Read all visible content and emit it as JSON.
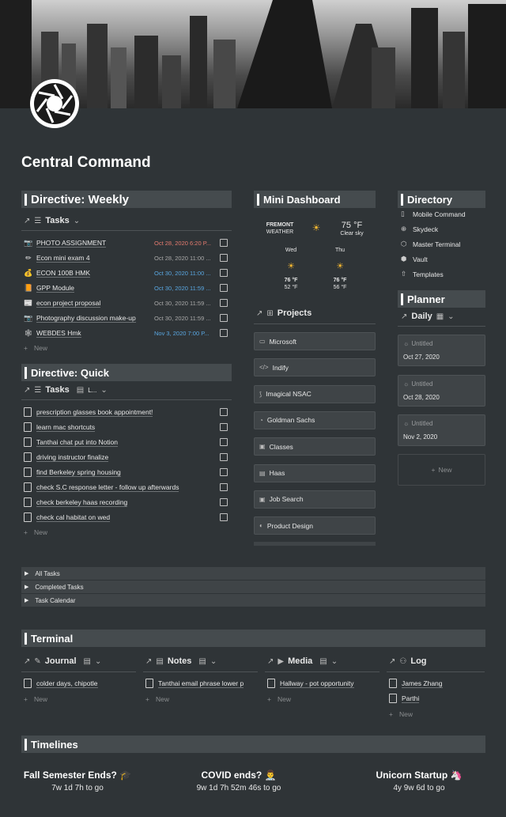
{
  "page": {
    "title": "Central Command"
  },
  "weekly": {
    "header": "Directive: Weekly",
    "view_label": "Tasks",
    "new_label": "New",
    "tasks": [
      {
        "icon": "📷",
        "name": "PHOTO ASSIGNMENT",
        "date": "Oct 28, 2020 6:20 P...",
        "status": "red"
      },
      {
        "icon": "✏",
        "name": "Econ mini exam 4",
        "date": "Oct 28, 2020 11:00 ...",
        "status": "gray"
      },
      {
        "icon": "💰",
        "name": "ECON 100B HMK",
        "date": "Oct 30, 2020 11:00 ...",
        "status": "blue"
      },
      {
        "icon": "📙",
        "name": "GPP Module",
        "date": "Oct 30, 2020 11:59 ...",
        "status": "blue"
      },
      {
        "icon": "📰",
        "name": "econ project proposal",
        "date": "Oct 30, 2020 11:59 ...",
        "status": "gray"
      },
      {
        "icon": "📷",
        "name": "Photography discussion make-up",
        "date": "Oct 30, 2020 11:59 ...",
        "status": "gray"
      },
      {
        "icon": "🕸",
        "name": "WEBDES Hmk",
        "date": "Nov 3, 2020 7:00 P...",
        "status": "blue"
      }
    ]
  },
  "quick": {
    "header": "Directive: Quick",
    "view_label": "Tasks",
    "view2_label": "L...",
    "new_label": "New",
    "tasks": [
      "prescription glasses book appointment!",
      "learn mac shortcuts",
      "Tanthai chat put into Notion",
      "driving instructor finalize",
      "find Berkeley spring housing",
      "check S.C response letter - follow up afterwards",
      "check berkeley haas recording",
      "check cal habitat on wed"
    ]
  },
  "dashboard": {
    "header": "Mini Dashboard",
    "weather": {
      "location": "FREMONT",
      "label": "WEATHER",
      "temp": "75 °F",
      "condition": "Clear sky",
      "days": [
        {
          "day": "Wed",
          "high": "76 °F",
          "low": "52 °F"
        },
        {
          "day": "Thu",
          "high": "76 °F",
          "low": "56 °F"
        }
      ]
    },
    "projects_label": "Projects",
    "projects": [
      "Microsoft",
      "Indify",
      "Imagical NSAC",
      "Goldman Sachs",
      "Classes",
      "Haas",
      "Job Search",
      "Product Design"
    ]
  },
  "directory": {
    "header": "Directory",
    "items": [
      "Mobile Command",
      "Skydeck",
      "Master Terminal",
      "Vault",
      "Templates"
    ]
  },
  "planner": {
    "header": "Planner",
    "view_label": "Daily",
    "new_label": "New",
    "cards": [
      {
        "title": "Untitled",
        "date": "Oct 27, 2020"
      },
      {
        "title": "Untitled",
        "date": "Oct 28, 2020"
      },
      {
        "title": "Untitled",
        "date": "Nov 2, 2020"
      }
    ]
  },
  "toggles": [
    "All Tasks",
    "Completed Tasks",
    "Task Calendar"
  ],
  "terminal": {
    "header": "Terminal",
    "new_label": "New",
    "columns": [
      {
        "label": "Journal",
        "items": [
          "colder days, chipotle"
        ]
      },
      {
        "label": "Notes",
        "items": [
          "Tanthai email phrase lower p"
        ]
      },
      {
        "label": "Media",
        "items": [
          "Hallway - pot opportunity"
        ]
      },
      {
        "label": "Log",
        "items": [
          "James Zhang",
          "Parthi"
        ]
      }
    ]
  },
  "timelines": {
    "header": "Timelines",
    "items": [
      {
        "title": "Fall Semester Ends? 🎓",
        "countdown": "7w 1d 7h to go"
      },
      {
        "title": "COVID ends? 👨‍⚕️",
        "countdown": "9w 1d 7h 52m 46s to go"
      },
      {
        "title": "Unicorn Startup 🦄",
        "countdown": "4y 9w 6d to go"
      }
    ]
  }
}
